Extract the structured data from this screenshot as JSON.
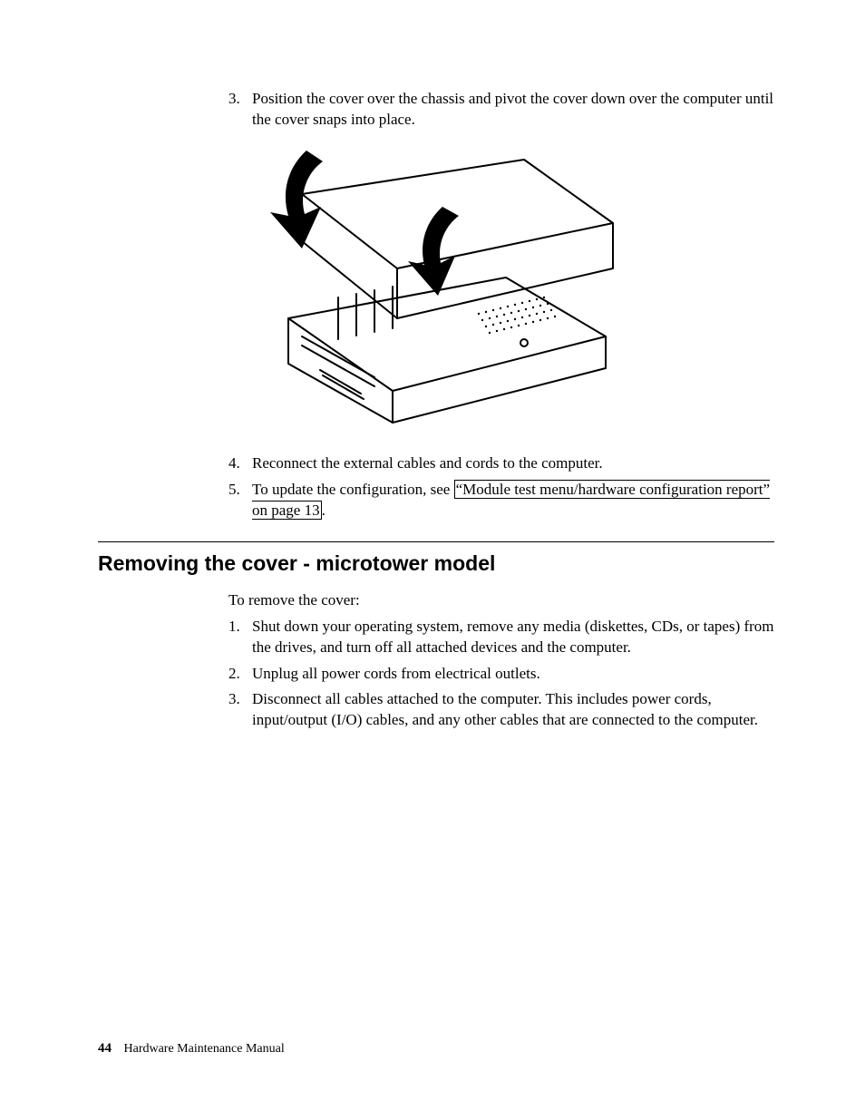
{
  "list1": {
    "items": [
      {
        "num": "3.",
        "text": "Position the cover over the chassis and pivot the cover down over the computer until the cover snaps into place."
      },
      {
        "num": "4.",
        "text": "Reconnect the external cables and cords to the computer."
      },
      {
        "num": "5.",
        "pre": "To update the configuration, see ",
        "link": "“Module test menu/hardware configuration report” on page 13",
        "post": "."
      }
    ]
  },
  "section": {
    "heading": "Removing the cover - microtower model",
    "intro": "To remove the cover:"
  },
  "list2": {
    "items": [
      {
        "num": "1.",
        "text": "Shut down your operating system, remove any media (diskettes, CDs, or tapes) from the drives, and turn off all attached devices and the computer."
      },
      {
        "num": "2.",
        "text": "Unplug all power cords from electrical outlets."
      },
      {
        "num": "3.",
        "text": "Disconnect all cables attached to the computer. This includes power cords, input/output (I/O) cables, and any other cables that are connected to the computer."
      }
    ]
  },
  "footer": {
    "page": "44",
    "title": "Hardware Maintenance Manual"
  }
}
